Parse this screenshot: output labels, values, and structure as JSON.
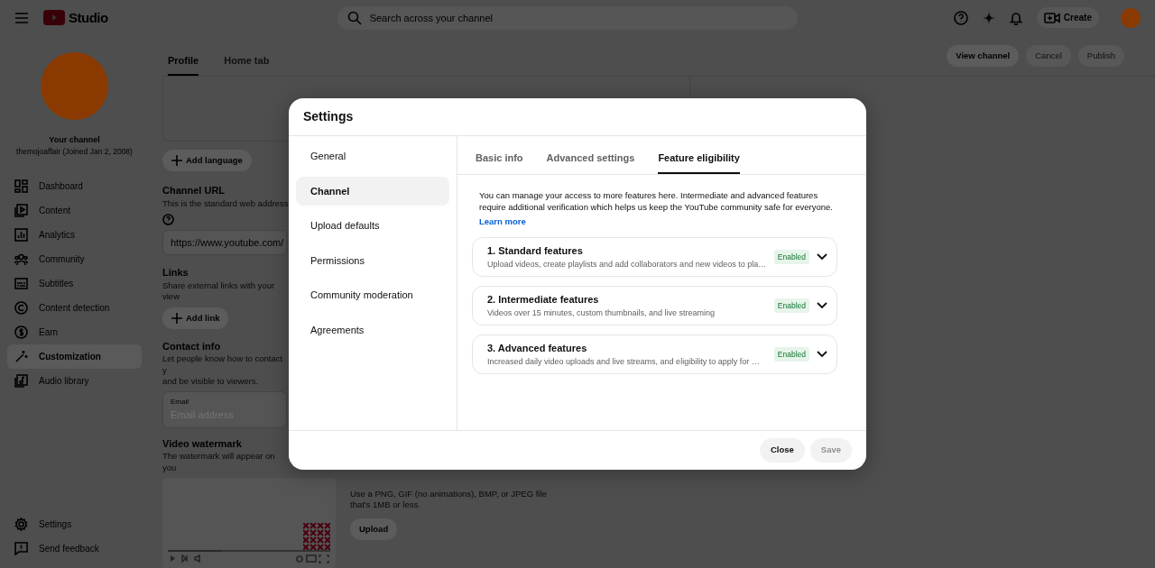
{
  "topbar": {
    "logo_text": "Studio",
    "search": {
      "placeholder": "Search across your channel"
    },
    "create_button": "Create"
  },
  "sidebar": {
    "channel_title": "Your channel",
    "channel_subtitle": "themojoaffair (Joined Jan 2, 2008)",
    "items": [
      {
        "label": "Dashboard",
        "selected": false
      },
      {
        "label": "Content",
        "selected": false
      },
      {
        "label": "Analytics",
        "selected": false
      },
      {
        "label": "Community",
        "selected": false
      },
      {
        "label": "Subtitles",
        "selected": false
      },
      {
        "label": "Content detection",
        "selected": false
      },
      {
        "label": "Earn",
        "selected": false
      },
      {
        "label": "Customization",
        "selected": true
      },
      {
        "label": "Audio library",
        "selected": false
      }
    ],
    "footer_items": [
      {
        "label": "Settings"
      },
      {
        "label": "Send feedback"
      }
    ]
  },
  "page": {
    "tabs": [
      {
        "label": "Profile",
        "selected": true
      },
      {
        "label": "Home tab",
        "selected": false
      }
    ],
    "actions": [
      {
        "label": "View channel",
        "disabled": false
      },
      {
        "label": "Cancel",
        "disabled": true
      },
      {
        "label": "Publish",
        "disabled": true
      }
    ],
    "add_language_button": "Add language",
    "channel_url": {
      "title": "Channel URL",
      "description": "This is the standard web address",
      "value": "https://www.youtube.com/"
    },
    "links": {
      "title": "Links",
      "description": "Share external links with your view",
      "button": "Add link"
    },
    "contact_info": {
      "title": "Contact info",
      "description_lines": [
        "Let people know how to contact y",
        "and be visible to viewers."
      ],
      "email": {
        "label": "Email",
        "placeholder": "Email address"
      }
    },
    "video_watermark": {
      "title": "Video watermark",
      "description": "The watermark will appear on you",
      "hint_lines": [
        "Use a PNG, GIF (no animations), BMP, or JPEG file",
        "that's 1MB or less."
      ],
      "upload_button": "Upload"
    }
  },
  "dialog": {
    "title": "Settings",
    "nav": [
      {
        "label": "General",
        "selected": false
      },
      {
        "label": "Channel",
        "selected": true
      },
      {
        "label": "Upload defaults",
        "selected": false
      },
      {
        "label": "Permissions",
        "selected": false
      },
      {
        "label": "Community moderation",
        "selected": false
      },
      {
        "label": "Agreements",
        "selected": false
      }
    ],
    "tabs": [
      {
        "label": "Basic info",
        "selected": false
      },
      {
        "label": "Advanced settings",
        "selected": false
      },
      {
        "label": "Feature eligibility",
        "selected": true
      }
    ],
    "intro": "You can manage your access to more features here. Intermediate and advanced features require additional verification which helps us keep the YouTube community safe for everyone.",
    "learn_more": "Learn more",
    "features": [
      {
        "title": "1. Standard features",
        "description": "Upload videos, create playlists and add collaborators and new videos to pla…",
        "status": "Enabled",
        "expanded": false
      },
      {
        "title": "2. Intermediate features",
        "description": "Videos over 15 minutes, custom thumbnails, and live streaming",
        "status": "Enabled",
        "expanded": false
      },
      {
        "title": "3. Advanced features",
        "description": "Increased daily video uploads and live streams, and eligibility to apply for …",
        "status": "Enabled",
        "expanded": false
      }
    ],
    "buttons": [
      {
        "label": "Close",
        "disabled": false
      },
      {
        "label": "Save",
        "disabled": true
      }
    ]
  }
}
